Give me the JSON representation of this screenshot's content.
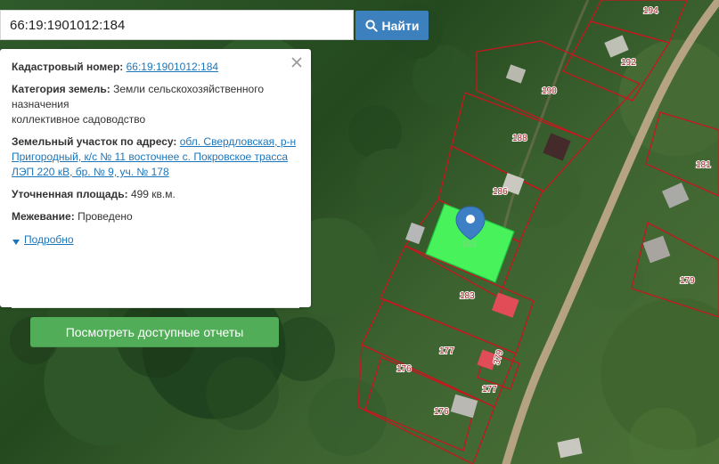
{
  "search": {
    "value": "66:19:1901012:184",
    "button_label": "Найти"
  },
  "info": {
    "cadastral_label": "Кадастровый номер:",
    "cadastral_number": "66:19:1901012:184",
    "land_category_label": "Категория земель:",
    "land_category_value": "Земли сельскохозяйственного назначения",
    "land_use_value": "коллективное садоводство",
    "address_label": "Земельный участок по адресу:",
    "address_value": "обл. Свердловская, р-н Пригородный, к/с № 11 восточнее с. Покровское трасса ЛЭП 220 кВ, бр. № 9, уч. № 178",
    "area_label": "Уточненная площадь:",
    "area_value": "499 кв.м.",
    "survey_label": "Межевание:",
    "survey_value": "Проведено",
    "details_label": "Подробно",
    "report_button": "Посмотреть доступные отчеты"
  },
  "map": {
    "selected_label": "183",
    "labels": [
      {
        "text": "194"
      },
      {
        "text": "192"
      },
      {
        "text": "190"
      },
      {
        "text": "188"
      },
      {
        "text": "181"
      },
      {
        "text": "186"
      },
      {
        "text": "183"
      },
      {
        "text": "179"
      },
      {
        "text": "177"
      },
      {
        "text": "379"
      },
      {
        "text": "176"
      },
      {
        "text": "177"
      },
      {
        "text": "176"
      }
    ],
    "colors": {
      "parcel_line": "#c7161f",
      "selected_fill": "#48f25a",
      "marker": "#3d7fc5",
      "road": "#ac9a79"
    }
  },
  "icons": {
    "search": "search-icon",
    "close": "close-icon",
    "details": "triangle-down-icon",
    "marker": "map-marker-icon"
  }
}
